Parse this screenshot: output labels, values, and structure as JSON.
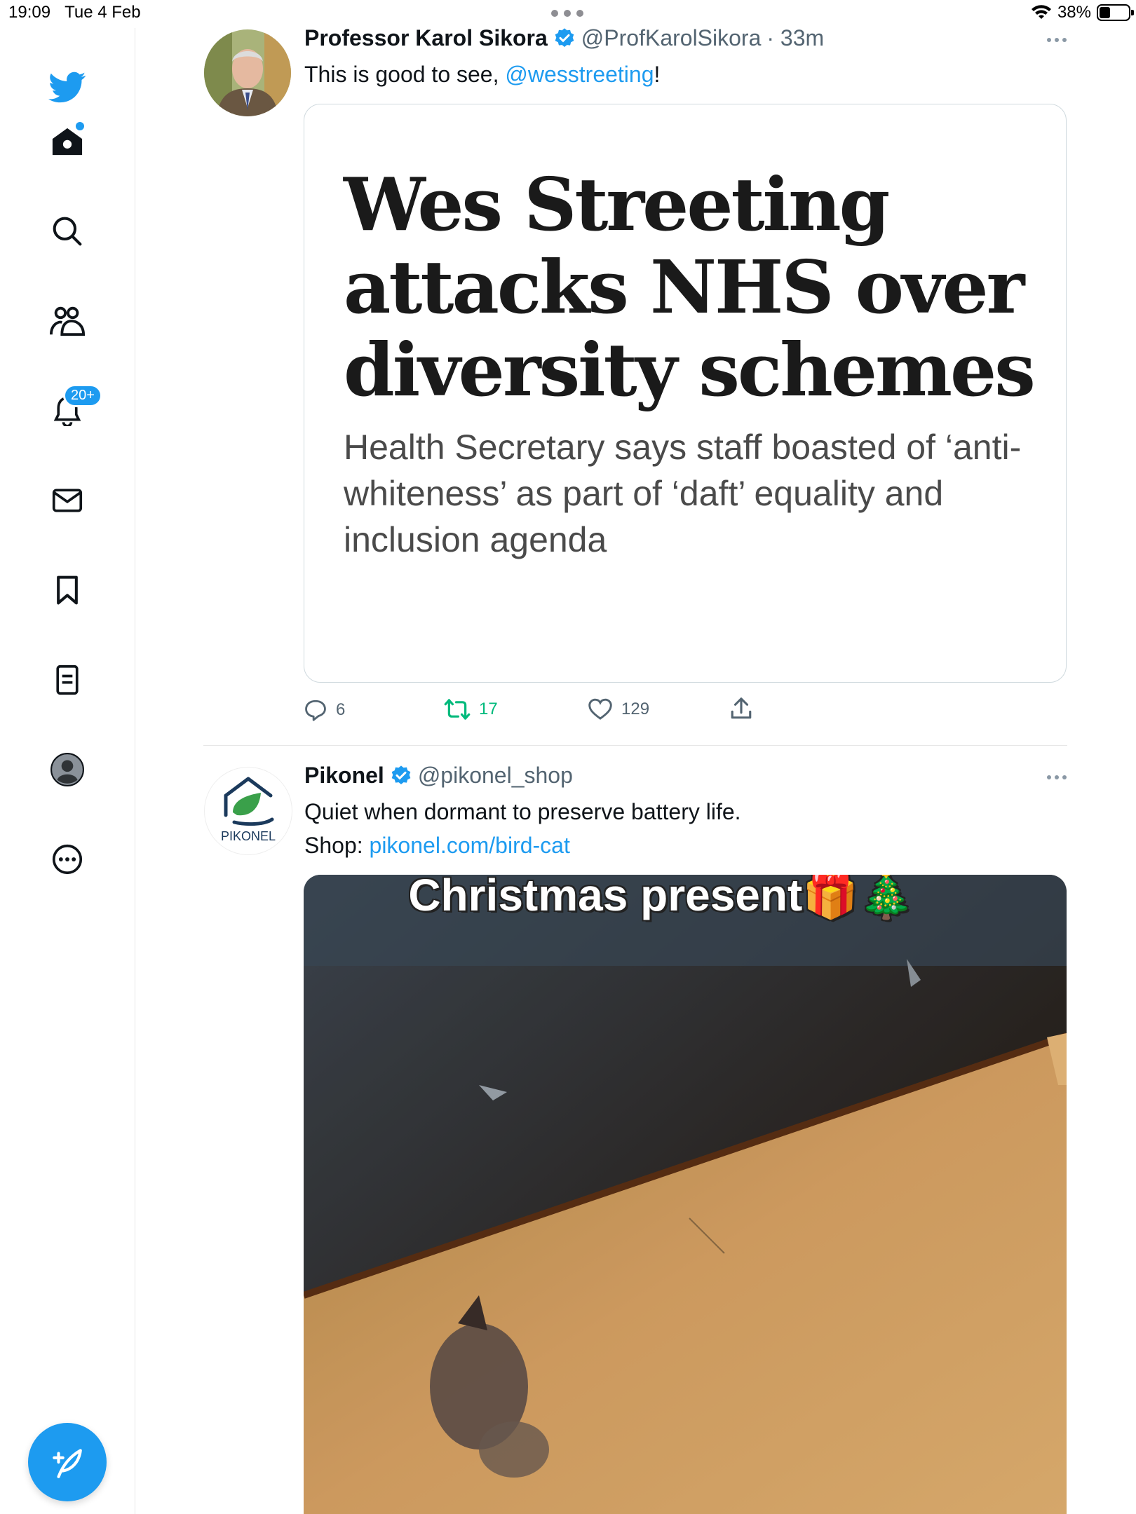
{
  "status_bar": {
    "time": "19:09",
    "date": "Tue 4 Feb",
    "battery": "38%"
  },
  "sidebar": {
    "notifications_badge": "20+",
    "items": [
      {
        "name": "home"
      },
      {
        "name": "search"
      },
      {
        "name": "communities"
      },
      {
        "name": "notifications"
      },
      {
        "name": "messages"
      },
      {
        "name": "bookmarks"
      },
      {
        "name": "lists"
      },
      {
        "name": "profile"
      },
      {
        "name": "more"
      }
    ]
  },
  "tweets": [
    {
      "name": "Professor Karol Sikora",
      "handle": "@ProfKarolSikora",
      "time": "· 33m",
      "text_prefix": "This is good to see, ",
      "mention": "@wesstreeting",
      "text_suffix": "!",
      "card": {
        "headline": "Wes Streeting attacks NHS over diversity schemes",
        "standfirst": "Health Secretary says staff boasted of ‘anti-whiteness’ as part of ‘daft’ equality and inclusion agenda"
      },
      "replies": "6",
      "retweets": "17",
      "likes": "129"
    },
    {
      "name": "Pikonel",
      "handle": "@pikonel_shop",
      "avatar_label": "PIKONEL",
      "line1": "Quiet when dormant to preserve battery life.",
      "line2_prefix": "Shop: ",
      "link": "pikonel.com/bird-cat",
      "media_caption": "Christmas present🎁🎄"
    }
  ],
  "colors": {
    "accent": "#1d9bf0",
    "retweet_active": "#00ba7c"
  }
}
